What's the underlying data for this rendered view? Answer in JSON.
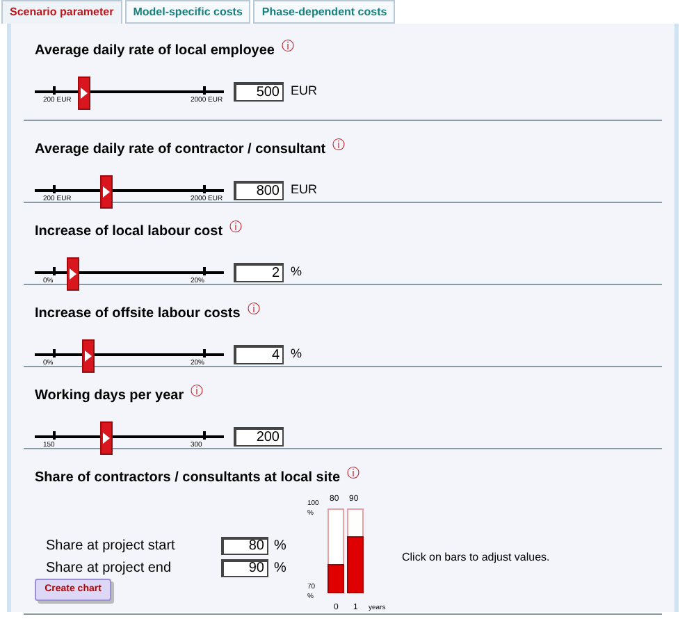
{
  "tabs": [
    {
      "label": "Scenario parameter",
      "selected": true
    },
    {
      "label": "Model-specific costs",
      "selected": false
    },
    {
      "label": "Phase-dependent costs",
      "selected": false
    }
  ],
  "sections": [
    {
      "kind": "slider",
      "title": "Average daily rate of local employee",
      "info": "ⓘ",
      "min_label": "200 EUR",
      "max_label": "2000 EUR",
      "level": 0.26,
      "value": "500",
      "unit": "EUR"
    },
    {
      "kind": "slider",
      "title": "Average daily rate of contractor / consultant",
      "info": "ⓘ",
      "min_label": "200 EUR",
      "max_label": "2000 EUR",
      "level": 0.375,
      "value": "800",
      "unit": "EUR"
    },
    {
      "kind": "slider",
      "title": "Increase of local labour cost",
      "info": "ⓘ",
      "min_label": "0%",
      "max_label": "20%",
      "level": 0.2,
      "value": "2",
      "unit": "%"
    },
    {
      "kind": "slider",
      "title": "Increase of offsite labour costs",
      "info": "ⓘ",
      "min_label": "0%",
      "max_label": "20%",
      "level": 0.28,
      "value": "4",
      "unit": "%"
    },
    {
      "kind": "slider",
      "title": "Working days per year",
      "info": "ⓘ",
      "min_label": "150",
      "max_label": "300",
      "level": 0.375,
      "value": "200"
    },
    {
      "kind": "share",
      "title": "Share of contractors / consultants at local site",
      "info": "ⓘ",
      "fields": [
        {
          "label": "Share at project start",
          "value": "80",
          "unit": "%"
        },
        {
          "label": "Share at project end",
          "value": "90",
          "unit": "%"
        }
      ],
      "button": "Create chart",
      "chart_data": {
        "type": "bar",
        "categories": [
          "0",
          "1"
        ],
        "values": [
          80,
          90
        ],
        "xlabel": "years",
        "ylim": [
          70,
          100
        ],
        "yticks": [
          {
            "value": 70,
            "label": "70 %"
          },
          {
            "value": 100,
            "label": "100 %"
          }
        ]
      },
      "bar_headers": [
        "80",
        "90"
      ],
      "hint": "Click on bars to adjust values."
    }
  ]
}
